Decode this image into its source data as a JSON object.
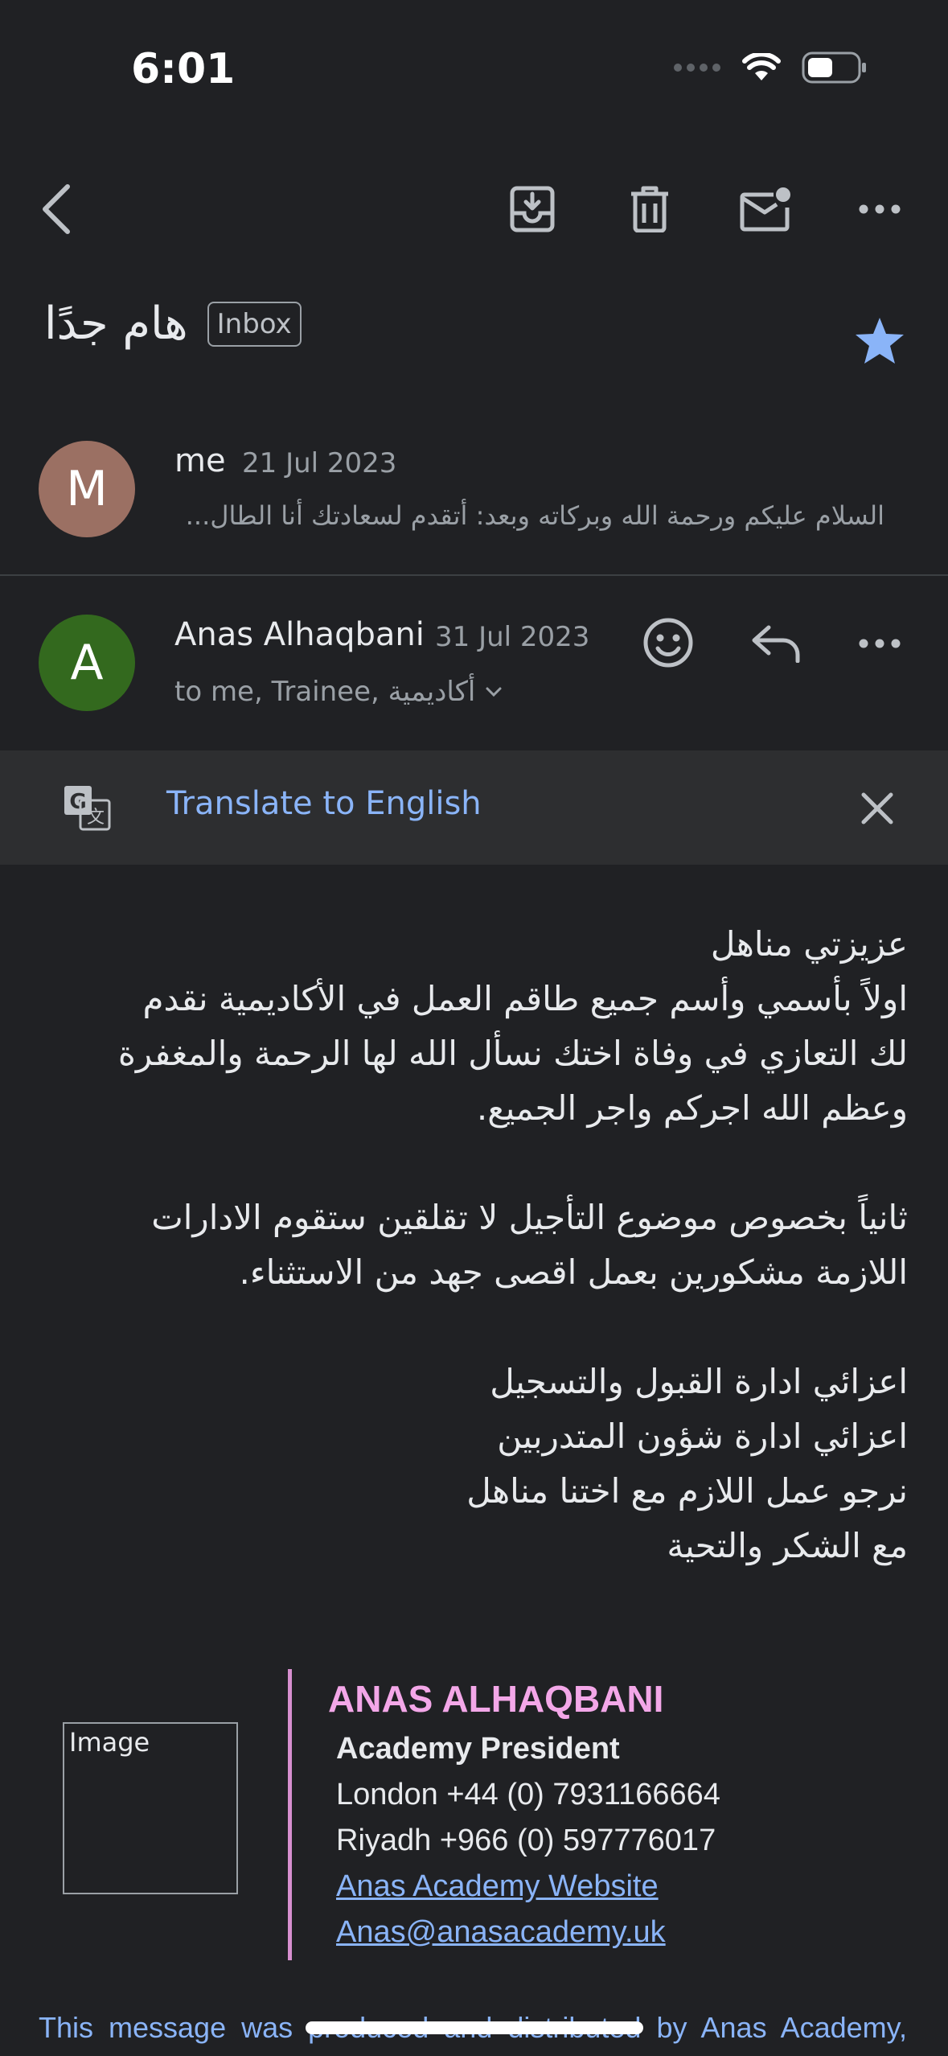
{
  "status_bar": {
    "time": "6:01",
    "battery_icon": "battery-icon",
    "wifi_icon": "wifi-icon"
  },
  "toolbar": {
    "back_icon": "back-arrow-icon",
    "archive_icon": "archive-icon",
    "delete_icon": "delete-icon",
    "mark_unread_icon": "mark-unread-icon",
    "more_icon": "more-icon"
  },
  "subject": {
    "text": "هام جدًا",
    "label": "Inbox",
    "starred": true,
    "star_color": "#8ab4f8"
  },
  "messages": [
    {
      "avatar_letter": "M",
      "avatar_color": "#9b7063",
      "sender": "me",
      "date": "21 Jul 2023",
      "snippet": "السلام عليكم ورحمة الله وبركاته وبعد: أتقدم لسعادتك أنا الطال..."
    },
    {
      "avatar_letter": "A",
      "avatar_color": "#33691e",
      "sender": "Anas Alhaqbani",
      "date": "31 Jul 2023",
      "recipients": "to me, Trainee, أكاديمية"
    }
  ],
  "translate": {
    "label": "Translate to English",
    "icon": "translate-icon",
    "close_icon": "close-icon"
  },
  "body": {
    "para1": [
      "عزيزتي مناهل",
      "اولاً بأسمي وأسم جميع طاقم العمل في الأكاديمية نقدم",
      "لك التعازي في وفاة اختك نسأل الله لها الرحمة والمغفرة",
      "وعظم الله اجركم واجر الجميع."
    ],
    "para2": [
      "ثانياً بخصوص موضوع التأجيل لا تقلقين ستقوم الادارات",
      "اللازمة مشكورين بعمل اقصى جهد من الاستثناء."
    ],
    "para3": [
      "اعزائي ادارة القبول والتسجيل",
      "اعزائي ادارة شؤون المتدربين",
      "نرجو عمل اللازم مع اختنا مناهل",
      "مع الشكر والتحية"
    ]
  },
  "signature": {
    "image_alt": "Image",
    "name": "ANAS ALHAQBANI",
    "title": "Academy President",
    "london": "London +44 (0) 7931166664",
    "riyadh": "Riyadh +966 (0) 597776017",
    "website": "Anas Academy Website",
    "email": "Anas@anasacademy.uk "
  },
  "footer": "This message was produced and distributed by Anas Academy,"
}
